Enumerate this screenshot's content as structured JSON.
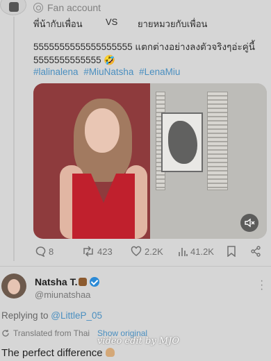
{
  "header": {
    "fan_label": "Fan account"
  },
  "post": {
    "vs_left": "พี่น้ากับเพื่อน",
    "vs_mid": "VS",
    "vs_right": "ยายหมวยกับเพื่อน",
    "text_line1": "5555555555555555555 แตกต่างอย่างลงตัวจริงๆอ่ะคู่นี้",
    "text_line2": "5555555555555 🤣",
    "hashtags": [
      "#lalinalena",
      "#MiuNatsha",
      "#LenaMiu"
    ],
    "actions": {
      "replies": "8",
      "reposts": "423",
      "likes": "2.2K",
      "views": "41.2K"
    }
  },
  "reply": {
    "name": "Natsha T.",
    "handle": "@miunatshaa",
    "replying_prefix": "Replying to ",
    "replying_to": "@LittleP_05",
    "translated_label": "Translated from Thai",
    "show_original": "Show original",
    "text": "The perfect difference"
  },
  "watermark": "video edit by MJO",
  "icons": {
    "fan": "fan-account-icon",
    "reply": "reply-icon",
    "repost": "repost-icon",
    "like": "heart-icon",
    "views": "views-icon",
    "bookmark": "bookmark-icon",
    "share": "share-icon",
    "volume": "mute-icon",
    "verified": "verified-badge-icon"
  },
  "colors": {
    "link": "#4a8fc0",
    "verified": "#2b8ad6",
    "dress": "#c0202d"
  }
}
